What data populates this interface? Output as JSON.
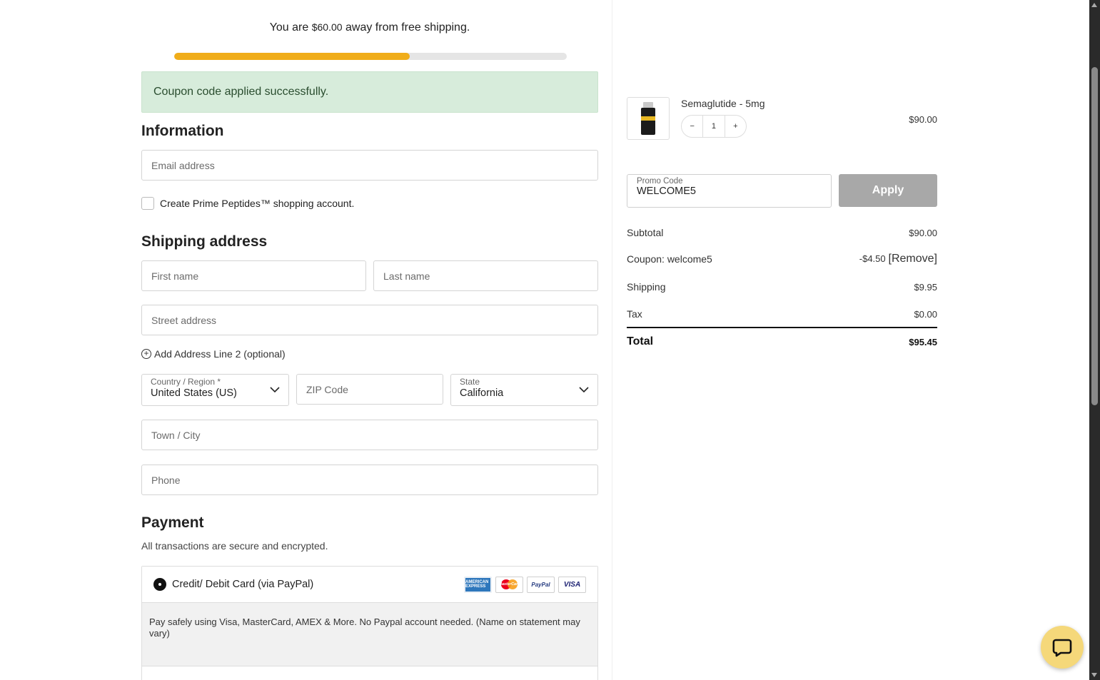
{
  "shipping_banner": {
    "prefix": "You are ",
    "amount": "$60.00",
    "suffix": " away from free shipping.",
    "progress": 0.6
  },
  "notice": "Coupon code applied successfully.",
  "information": {
    "heading": "Information",
    "email_placeholder": "Email address",
    "create_account_label": "Create Prime Peptides™ shopping account."
  },
  "shipping": {
    "heading": "Shipping address",
    "first_name_placeholder": "First name",
    "last_name_placeholder": "Last name",
    "street_placeholder": "Street address",
    "add_line2": "Add Address Line 2 (optional)",
    "country_label": "Country / Region *",
    "country_value": "United States (US)",
    "zip_placeholder": "ZIP Code",
    "state_label": "State",
    "state_value": "California",
    "city_placeholder": "Town / City",
    "phone_placeholder": "Phone"
  },
  "payment": {
    "heading": "Payment",
    "subtitle": "All transactions are secure and encrypted.",
    "method_label": "Credit/ Debit Card (via PayPal)",
    "cards": [
      "AMERICAN EXPRESS",
      "MasterCard",
      "PayPal",
      "VISA"
    ],
    "description": "Pay safely using Visa, MasterCard, AMEX & More. No Paypal account needed. (Name on statement may vary)"
  },
  "cart": {
    "product_name": "Semaglutide - 5mg",
    "qty_minus": "−",
    "quantity": "1",
    "qty_plus": "+",
    "product_price": "$90.00"
  },
  "promo": {
    "label": "Promo Code",
    "value": "WELCOME5",
    "apply_label": "Apply"
  },
  "summary": {
    "subtotal_label": "Subtotal",
    "subtotal_value": "$90.00",
    "coupon_label": "Coupon: welcome5",
    "coupon_value": "-$4.50",
    "remove_label": "[Remove]",
    "shipping_label": "Shipping",
    "shipping_value": "$9.95",
    "tax_label": "Tax",
    "tax_value": "$0.00",
    "total_label": "Total",
    "total_value": "$95.45"
  },
  "colors": {
    "progress_fill": "#f0ad1a",
    "notice_bg": "#d7ecdb",
    "apply_button": "#a8a8a8",
    "chat_button": "#f5d87a"
  },
  "icons": {
    "chat": "chat-bubble-icon",
    "add": "plus-circle-icon",
    "dropdown": "chevron-down-icon"
  }
}
